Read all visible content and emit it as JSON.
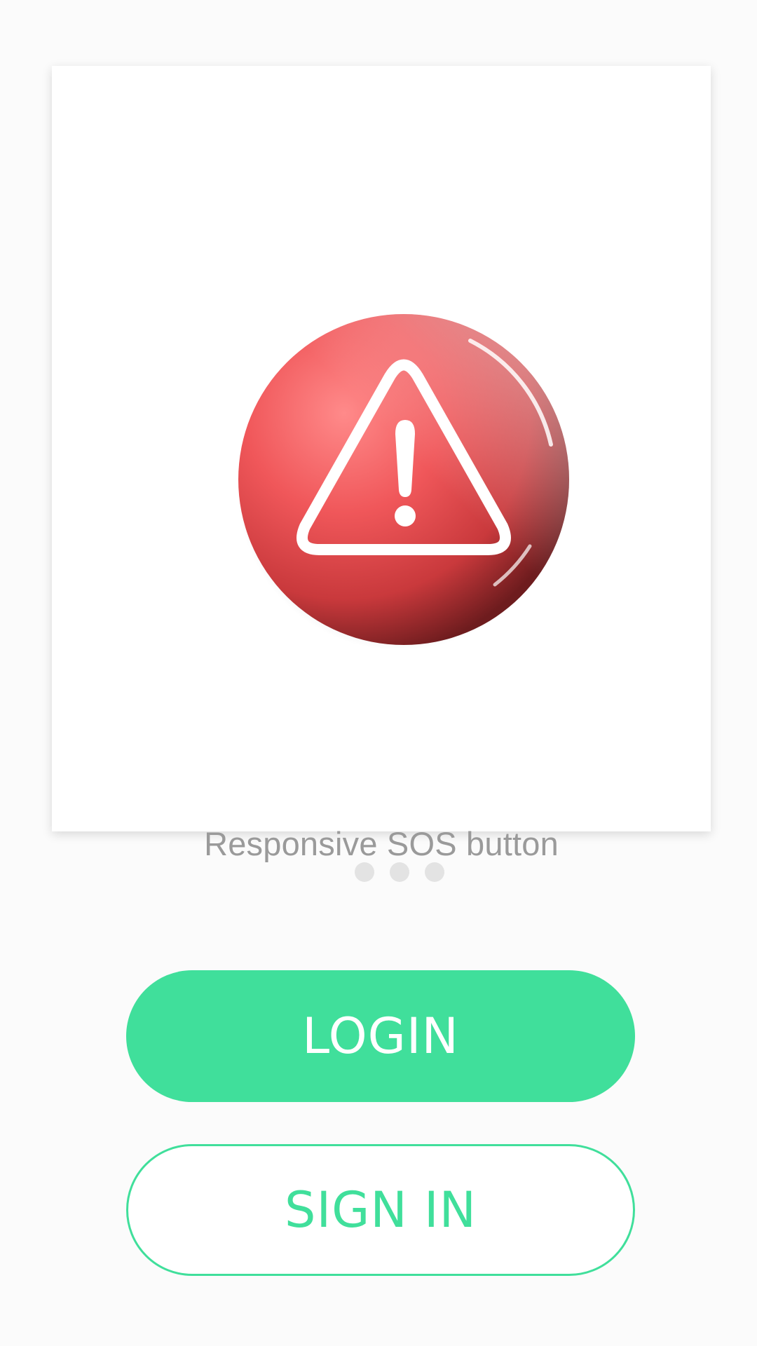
{
  "carousel": {
    "caption": "Responsive SOS button",
    "slide_count": 3,
    "active_index": null,
    "sos_icon": "warning-triangle-icon",
    "sos_color": "#e85b5e"
  },
  "actions": {
    "login_label": "LOGIN",
    "signin_label": "SIGN IN",
    "accent_color": "#40df9b"
  }
}
